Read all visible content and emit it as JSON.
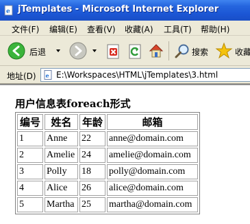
{
  "window": {
    "title": "jTemplates - Microsoft Internet Explorer"
  },
  "menu": [
    "文件(F)",
    "编辑(E)",
    "查看(V)",
    "收藏(A)",
    "工具(T)",
    "帮助(H)"
  ],
  "toolbar": {
    "back_label": "后退",
    "search_label": "搜索",
    "favorites_label": "收藏"
  },
  "address": {
    "label": "地址(D)",
    "value": "E:\\Workspaces\\HTML\\jTemplates\\3.html"
  },
  "page": {
    "heading": "用户信息表foreach形式",
    "table": {
      "headers": [
        "编号",
        "姓名",
        "年龄",
        "邮箱"
      ],
      "rows": [
        [
          "1",
          "Anne",
          "22",
          "anne@domain.com"
        ],
        [
          "2",
          "Amelie",
          "24",
          "amelie@domain.com"
        ],
        [
          "3",
          "Polly",
          "18",
          "polly@domain.com"
        ],
        [
          "4",
          "Alice",
          "26",
          "alice@domain.com"
        ],
        [
          "5",
          "Martha",
          "25",
          "martha@domain.com"
        ]
      ]
    }
  },
  "colors": {
    "titlebar": "#2565de",
    "chrome": "#ece9d8",
    "back_arrow": "#2aa52a",
    "stop_red": "#d82c20",
    "refresh_green": "#2f9b3a",
    "favorites_star": "#f4c20d"
  },
  "icons": {
    "app": "ie-page-icon",
    "back": "back-arrow-icon",
    "forward": "forward-arrow-icon",
    "stop": "stop-icon",
    "refresh": "refresh-icon",
    "home": "home-icon",
    "search": "search-icon",
    "favorites": "favorites-star-icon",
    "page": "page-icon"
  }
}
